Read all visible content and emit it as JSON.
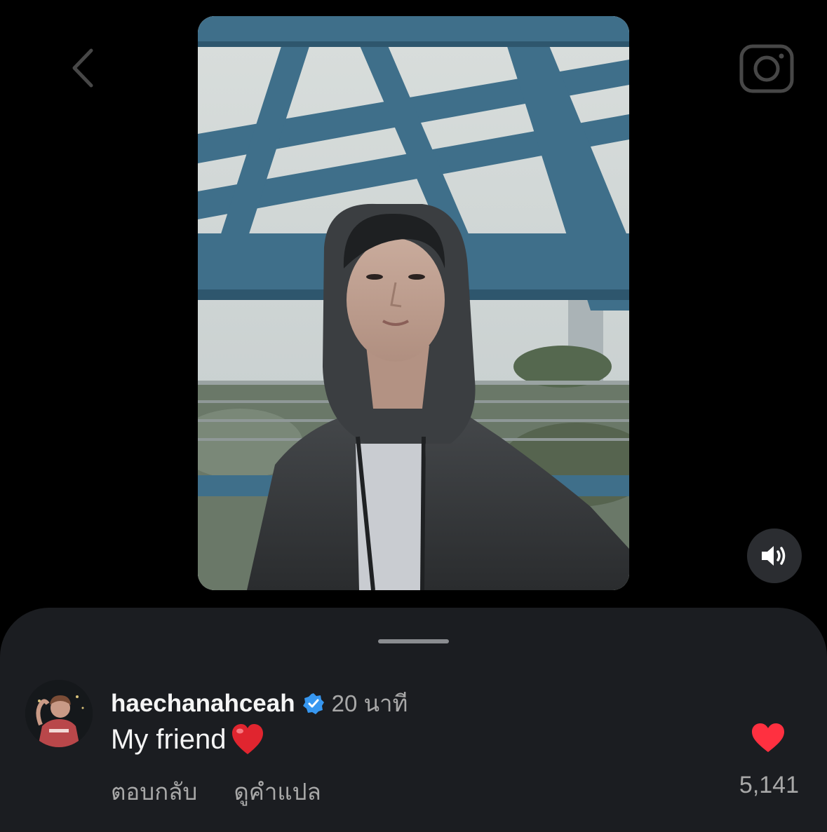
{
  "header": {
    "back_icon": "chevron-left-icon",
    "camera_icon": "camera-icon"
  },
  "media": {
    "type": "reel-video",
    "subject": "person in dark hoodie under blue steel bridge truss",
    "mute_icon": "speaker-on-icon"
  },
  "comment": {
    "username": "haechanahceah",
    "verified": true,
    "timestamp": "20 นาที",
    "text": "My friend",
    "emoji": "red-heart",
    "reply_label": "ตอบกลับ",
    "translate_label": "ดูคำแปล",
    "liked": true,
    "like_count": "5,141"
  },
  "colors": {
    "background": "#000000",
    "sheet": "#1b1d21",
    "primary_text": "#f5f5f5",
    "secondary_text": "#a8a8a8",
    "verified_blue": "#3797f0",
    "like_red": "#ff3040",
    "steel_blue": "#3f6f8a"
  }
}
